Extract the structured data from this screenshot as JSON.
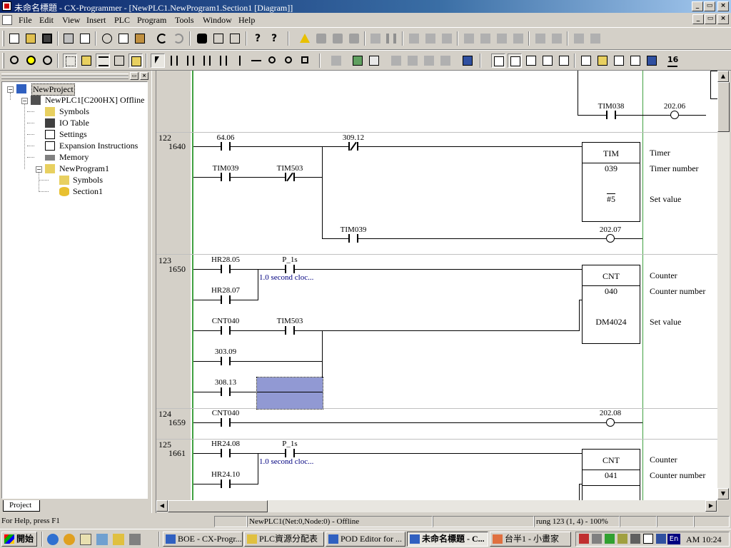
{
  "window": {
    "title": "未命名標題 - CX-Programmer - [NewPLC1.NewProgram1.Section1 [Diagram]]",
    "caption_buttons": [
      "_",
      "▭",
      "×"
    ]
  },
  "menu": {
    "items": [
      "File",
      "Edit",
      "View",
      "Insert",
      "PLC",
      "Program",
      "Tools",
      "Window",
      "Help"
    ]
  },
  "toolbar2": {
    "badge_label": "16"
  },
  "project_tree": {
    "root": "NewProject",
    "plc": "NewPLC1[C200HX] Offline",
    "plc_children": [
      "Symbols",
      "IO Table",
      "Settings",
      "Expansion Instructions",
      "Memory"
    ],
    "program": "NewProgram1",
    "program_children": [
      "Symbols",
      "Section1"
    ],
    "tab_label": "Project"
  },
  "diagram": {
    "rung_top": {
      "contact": "TIM038",
      "coil": "202.06"
    },
    "rung122": {
      "number": "122",
      "step": "1640",
      "c1": "64.06",
      "c2": "309.12",
      "c3": "TIM039",
      "c4": "TIM503",
      "c5": "TIM039",
      "coil": "202.07",
      "block": {
        "name": "TIM",
        "operand1": "039",
        "operand2": "#5"
      },
      "labels": [
        "Timer",
        "Timer number",
        "Set value"
      ]
    },
    "rung123": {
      "number": "123",
      "step": "1650",
      "c1": "HR28.05",
      "c2": "P_1s",
      "comment": "1.0 second cloc...",
      "c3": "HR28.07",
      "c4": "CNT040",
      "c5": "TIM503",
      "c6": "303.09",
      "c7": "308.13",
      "block": {
        "name": "CNT",
        "operand1": "040",
        "operand2": "DM4024"
      },
      "labels": [
        "Counter",
        "Counter number",
        "Set value"
      ]
    },
    "rung124": {
      "number": "124",
      "step": "1659",
      "c1": "CNT040",
      "coil": "202.08"
    },
    "rung125": {
      "number": "125",
      "step": "1661",
      "c1": "HR24.08",
      "c2": "P_1s",
      "comment": "1.0 second cloc...",
      "c3": "HR24.10",
      "block": {
        "name": "CNT",
        "operand1": "041"
      },
      "labels": [
        "Counter",
        "Counter number"
      ]
    }
  },
  "statusbar": {
    "help": "For Help, press F1",
    "plc": "NewPLC1(Net:0,Node:0) - Offline",
    "position": "rung 123 (1, 4)  - 100%"
  },
  "taskbar": {
    "start": "開始",
    "tasks": [
      "BOE - CX-Progr...",
      "PLC資源分配表",
      "POD Editor for ...",
      "未命名標題 - C...",
      "台半1 - 小畫家"
    ],
    "lang": "En",
    "clock": "AM 10:24"
  }
}
